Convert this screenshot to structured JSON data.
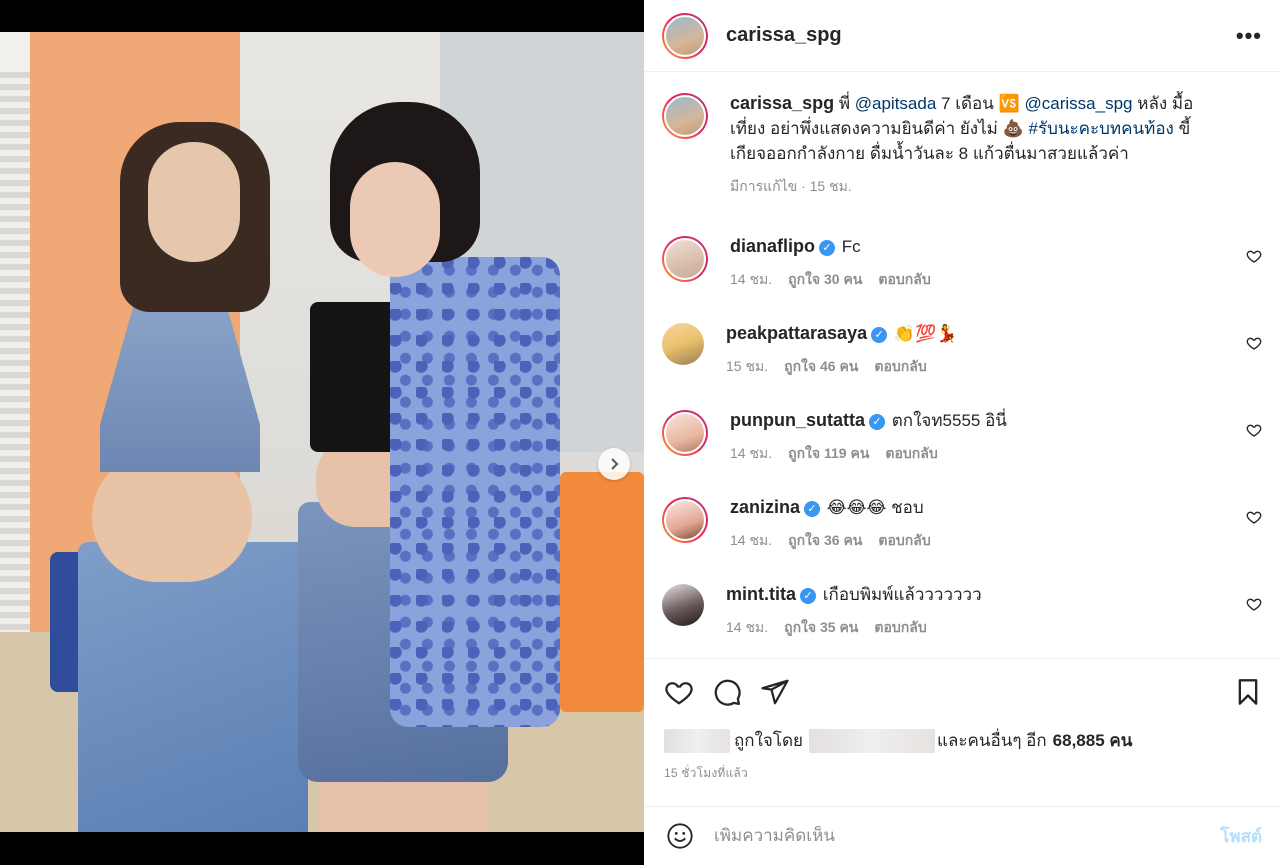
{
  "post": {
    "username": "carissa_spg",
    "more_icon": "more-horizontal-icon",
    "carousel": {
      "dots": 3,
      "active_index": 0
    }
  },
  "caption": {
    "username": "carissa_spg",
    "t1": "พี่",
    "mention1": "@apitsada",
    "t2": "7 เดือน",
    "vs_emoji": "🆚",
    "mention2": "@carissa_spg",
    "t3": "หลัง มื้อเที่ยง อย่าพึ่งแสดงความยินดีค่า ยังไม่",
    "poop_emoji": "💩",
    "hashtag": "#รับนะคะบทคนท้อง",
    "t4": "ขี้เกียจออกกำลังกาย ดื่มน้ำวันละ 8 แก้วตื่นมาสวยแล้วค่า",
    "meta": "มีการแก้ไข · 15 ชม."
  },
  "comments": [
    {
      "username": "dianaflipo",
      "text": "Fc",
      "time": "14 ชม.",
      "likes": "ถูกใจ 30 คน",
      "reply": "ตอบกลับ"
    },
    {
      "username": "peakpattarasaya",
      "text": "👏💯💃",
      "time": "15 ชม.",
      "likes": "ถูกใจ 46 คน",
      "reply": "ตอบกลับ"
    },
    {
      "username": "punpun_sutatta",
      "text": "ตกใจท5555 อินี่",
      "time": "14 ชม.",
      "likes": "ถูกใจ 119 คน",
      "reply": "ตอบกลับ"
    },
    {
      "username": "zanizina",
      "text": "😂😂😂 ชอบ",
      "time": "14 ชม.",
      "likes": "ถูกใจ 36 คน",
      "reply": "ตอบกลับ"
    },
    {
      "username": "mint.tita",
      "text": "เกือบพิมพ์แล้ววววววว",
      "time": "14 ชม.",
      "likes": "ถูกใจ 35 คน",
      "reply": "ตอบกลับ"
    }
  ],
  "likes": {
    "liked_by": "ถูกใจโดย",
    "and_others": "และคนอื่นๆ อีก",
    "count": "68,885 คน"
  },
  "time_ago": "15 ชั่วโมงที่แล้ว",
  "comment_box": {
    "placeholder": "เพิ่มความคิดเห็น",
    "post_label": "โพสต์"
  },
  "colors": {
    "link": "#00376b",
    "verified": "#3897f0",
    "muted": "#8e8e8e",
    "post_disabled": "#b2dffc"
  }
}
